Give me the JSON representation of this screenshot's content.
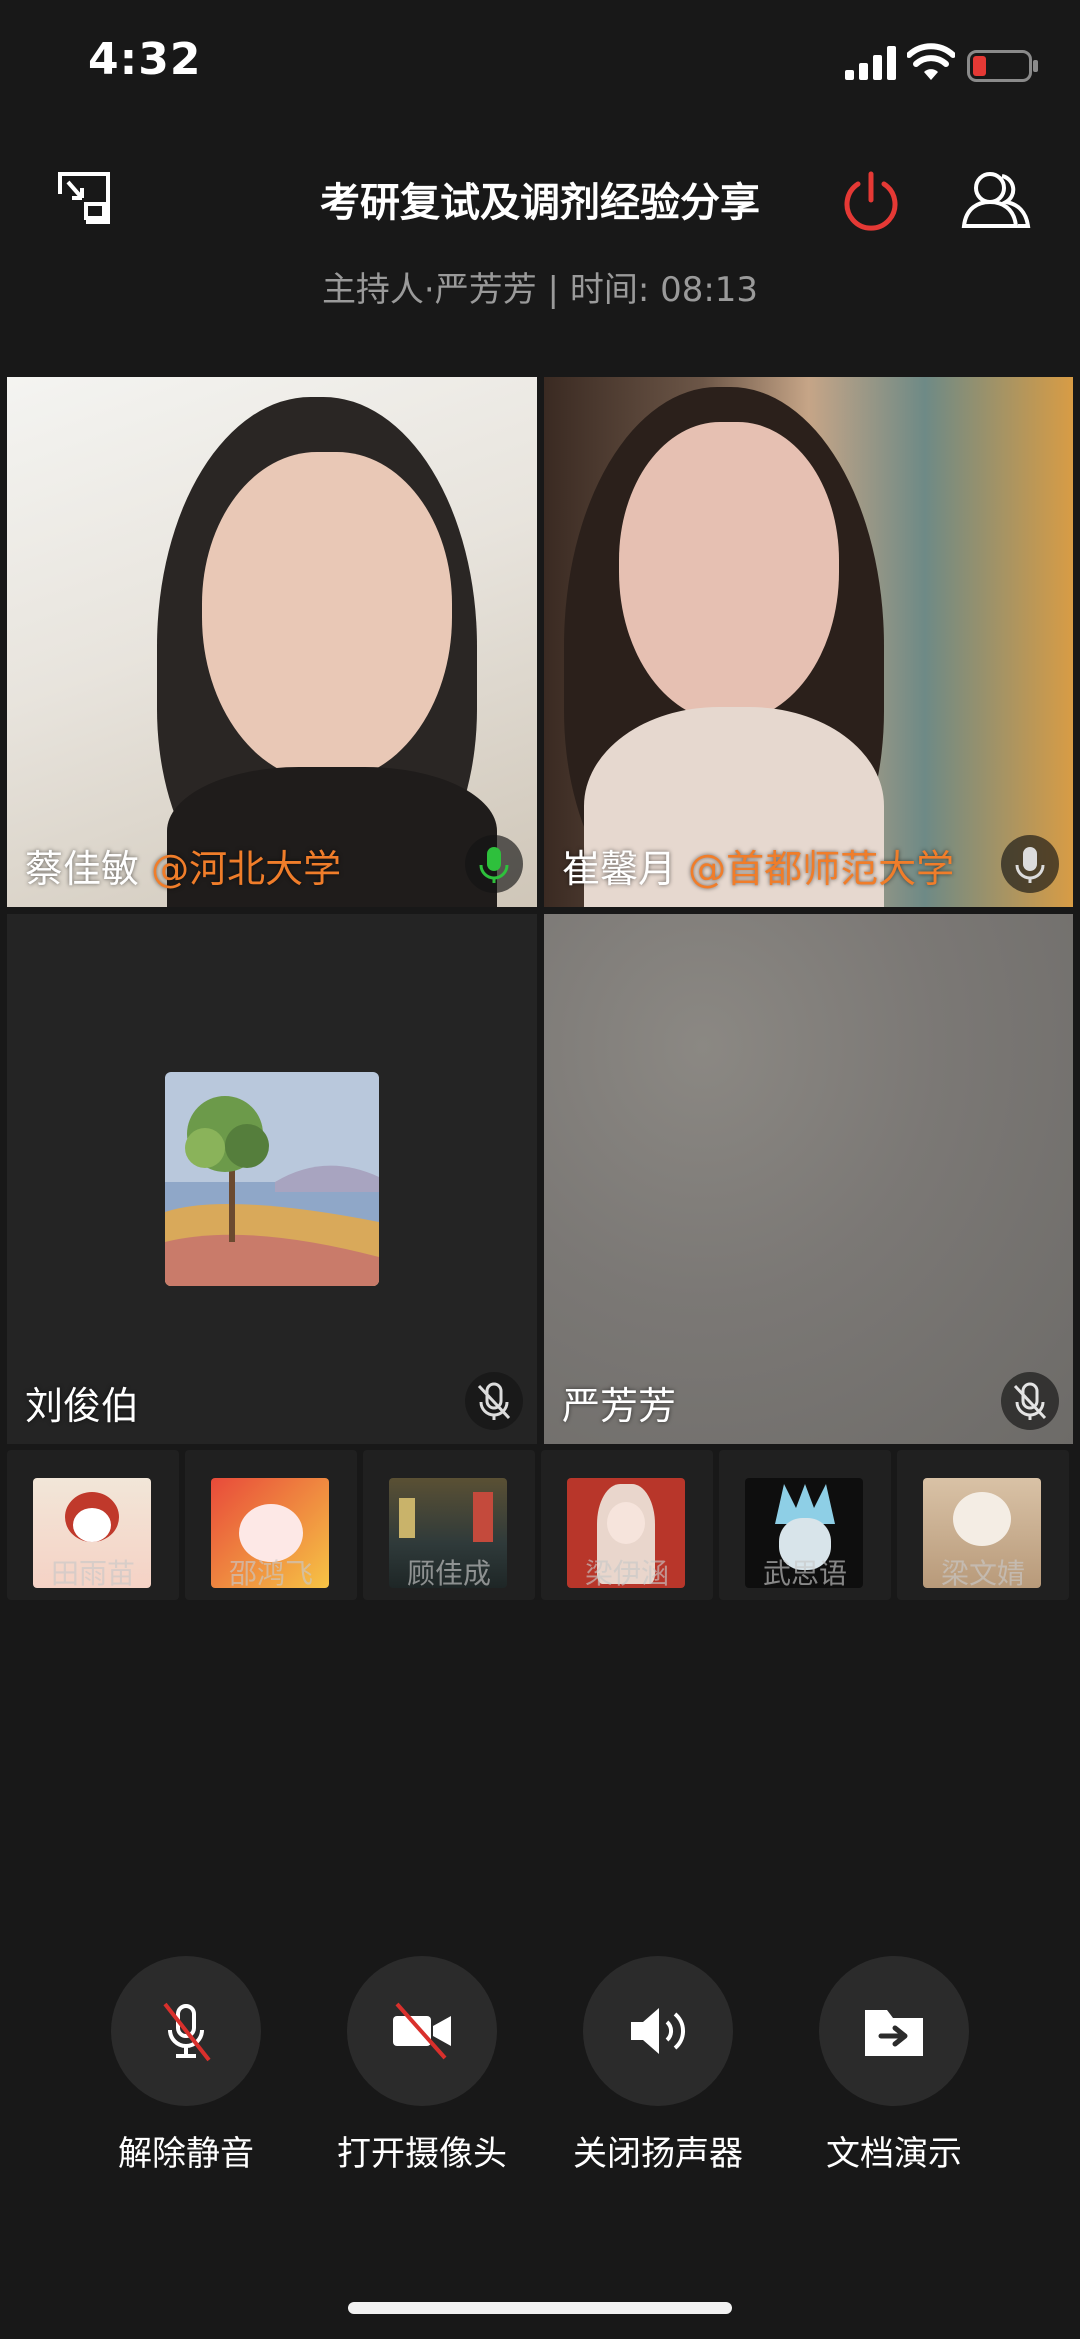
{
  "status_bar": {
    "time": "4:32",
    "battery_color": "#e53935"
  },
  "header": {
    "title": "考研复试及调剂经验分享",
    "host_line": "主持人·严芳芳 | 时间: 08:13",
    "power_color": "#e53935"
  },
  "tiles": [
    {
      "name": "蔡佳敏",
      "org": "@河北大学",
      "mic_state": "speaking",
      "mic_color": "#2ec03c"
    },
    {
      "name": "崔馨月",
      "org": "@首都师范大学",
      "mic_state": "on"
    },
    {
      "name": "刘俊伯",
      "org": "",
      "mic_state": "muted",
      "avatar": "impressionist-painting-avatar"
    },
    {
      "name": "严芳芳",
      "org": "",
      "mic_state": "muted"
    }
  ],
  "thumbnails": [
    {
      "name": "田雨苗",
      "avatar": "cartoon-girl-avatar"
    },
    {
      "name": "邵鸿飞",
      "avatar": "cartoon-pig-avatar"
    },
    {
      "name": "顾佳成",
      "avatar": "city-street-avatar"
    },
    {
      "name": "梁伊涵",
      "avatar": "anime-girl-avatar"
    },
    {
      "name": "武思语",
      "avatar": "rick-cartoon-avatar"
    },
    {
      "name": "梁文婧",
      "avatar": "cartoon-bear-avatar"
    }
  ],
  "controls": [
    {
      "label": "解除静音",
      "icon": "mic-off-icon"
    },
    {
      "label": "打开摄像头",
      "icon": "camera-off-icon"
    },
    {
      "label": "关闭扬声器",
      "icon": "speaker-icon"
    },
    {
      "label": "文档演示",
      "icon": "folder-share-icon"
    }
  ],
  "org_color": "#f07d2a"
}
